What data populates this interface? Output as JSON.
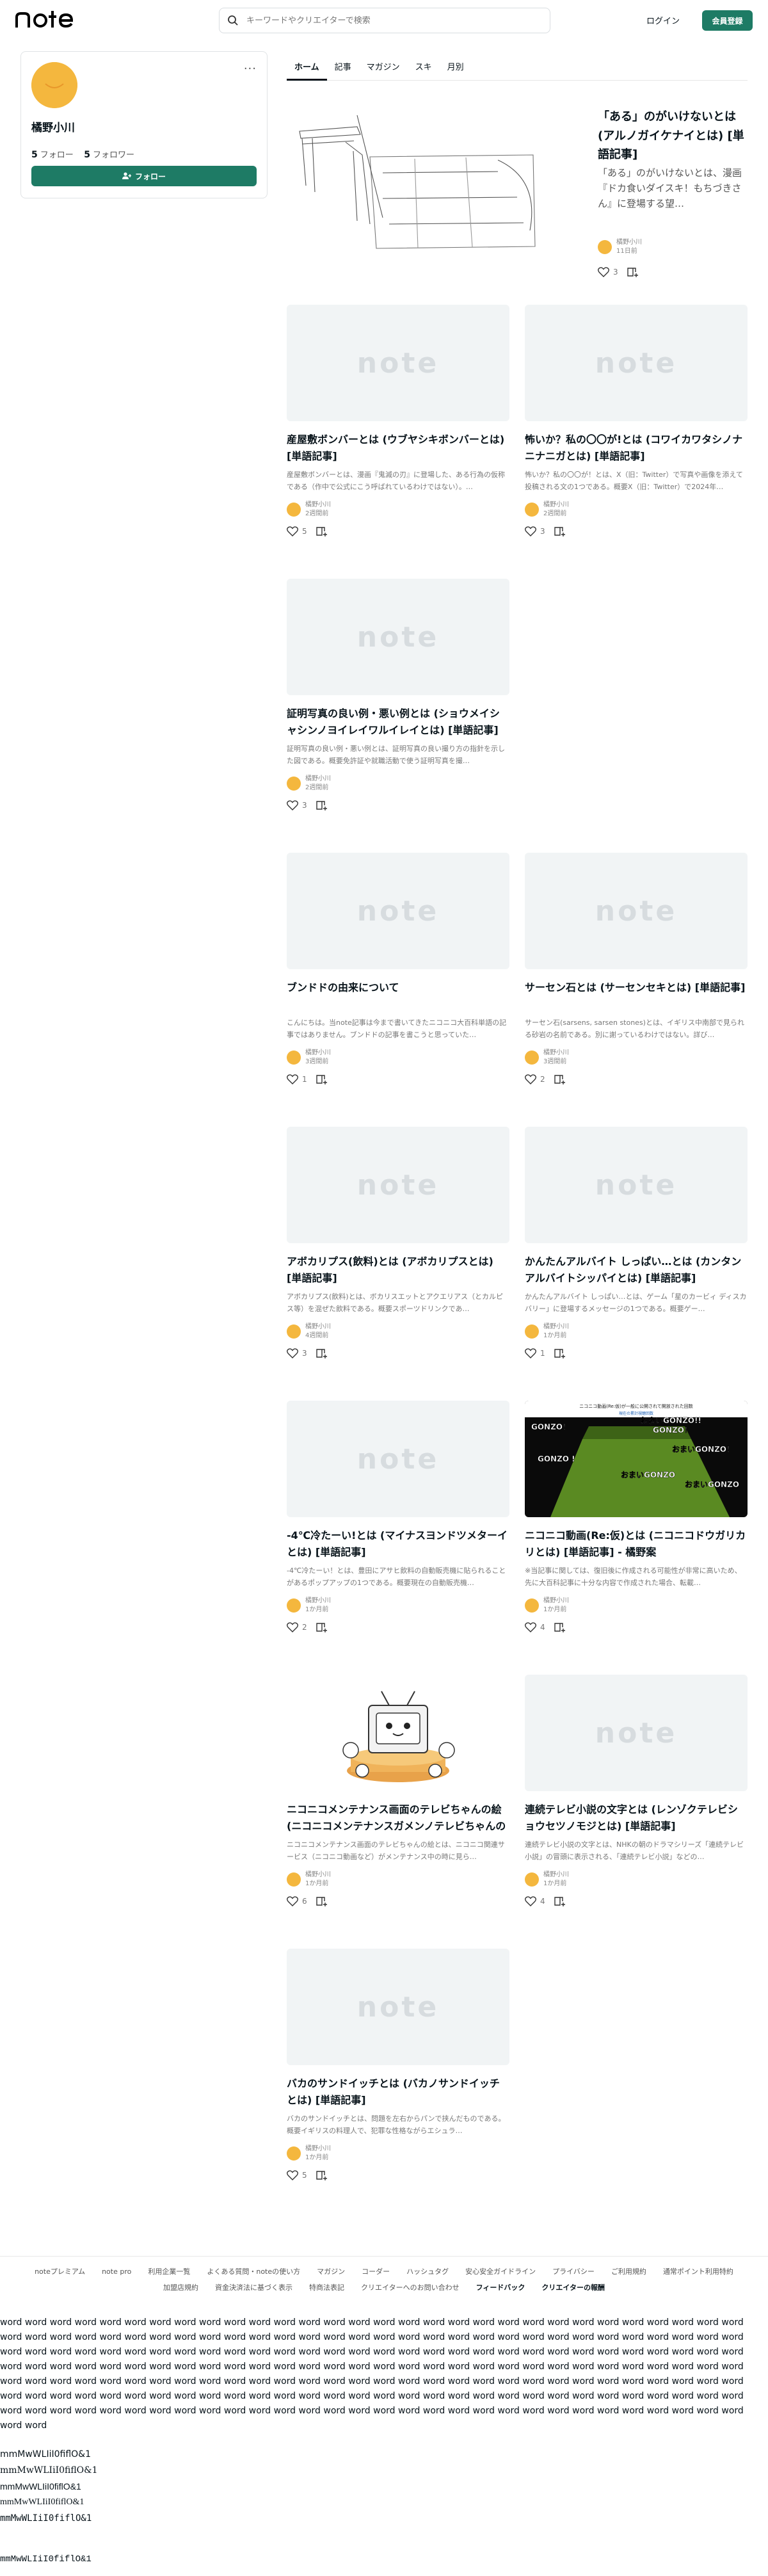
{
  "header": {
    "logo": "note",
    "search_placeholder": "キーワードやクリエイターで検索",
    "login": "ログイン",
    "signup": "会員登録"
  },
  "profile": {
    "name": "橘野小川",
    "following_count": "5",
    "following_label": "フォロー",
    "followers_count": "5",
    "followers_label": "フォロワー",
    "follow_button": "フォロー",
    "more": "···"
  },
  "tabs": [
    "ホーム",
    "記事",
    "マガジン",
    "スキ",
    "月別"
  ],
  "featured": {
    "title": "「ある」のがいけないとは (アルノガイケナイとは) [単語記事]",
    "excerpt": "「ある」のがいけないとは、漫画『ドカ食いダイスキ！もちづきさん』に登場する望…",
    "author": "橘野小川",
    "date": "11日前",
    "likes": "3"
  },
  "thumb_watermark": "note",
  "cards": [
    {
      "title": "産屋敷ボンバーとは (ウブヤシキボンバーとは) [単語記事]",
      "excerpt": "産屋敷ボンバーとは、漫画『鬼滅の刃』に登場した、ある行為の仮称である（作中で公式にこう呼ばれているわけではない）。…",
      "author": "橘野小川",
      "date": "2週間前",
      "likes": "5"
    },
    {
      "title": "怖いか？私の〇〇が!とは (コワイカワタシノナニナニガとは) [単語記事]",
      "excerpt": "怖いか？私の〇〇が！とは、X（旧：Twitter）で写真や画像を添えて投稿される文の1つである。概要X（旧：Twitter）で2024年…",
      "author": "橘野小川",
      "date": "2週間前",
      "likes": "3"
    },
    {
      "title": "証明写真の良い例・悪い例とは (ショウメイシャシンノヨイレイワルイレイとは) [単語記事]",
      "excerpt": "証明写真の良い例・悪い例とは、証明写真の良い撮り方の指針を示した図である。概要免許証や就職活動で使う証明写真を撮…",
      "author": "橘野小川",
      "date": "2週間前",
      "likes": "3"
    },
    {
      "title": "ブンドドの由来について",
      "excerpt": "こんにちは。当note記事は今まで書いてきたニコニコ大百科単語の記事ではありません。ブンドドの記事を書こうと思っていた…",
      "author": "橘野小川",
      "date": "3週間前",
      "likes": "1"
    },
    {
      "title": "サーセン石とは (サーセンセキとは) [単語記事]",
      "excerpt": "サーセン石(sarsens, sarsen stones)とは、イギリス中南部で見られる砂岩の名前である。別に謝っているわけではない。詳び…",
      "author": "橘野小川",
      "date": "3週間前",
      "likes": "2"
    },
    {
      "title": "アボカリプス(飲料)とは (アボカリプスとは) [単語記事]",
      "excerpt": "アボカリプス(飲料)とは、ボカリスエットとアクエリアス（とカルピス等）を混ぜた飲料である。概要スポーツドリンクであ…",
      "author": "橘野小川",
      "date": "4週間前",
      "likes": "3"
    },
    {
      "title": "かんたんアルバイト しっぱい…とは (カンタンアルバイトシッパイとは) [単語記事]",
      "excerpt": "かんたんアルバイト しっぱい…とは、ゲーム「星のカービィ ディスカバリー」に登場するメッセージの1つである。概要ゲー…",
      "author": "橘野小川",
      "date": "1か月前",
      "likes": "1"
    },
    {
      "title": "-4℃冷たーい!とは (マイナスヨンドツメターイとは) [単語記事]",
      "excerpt": "-4℃冷たーい！とは、豊田にアサヒ飲料の自動販売機に貼られることがあるポップアップの1つである。概要現在の自動販売機…",
      "author": "橘野小川",
      "date": "1か月前",
      "likes": "2"
    },
    {
      "title": "ニコニコ動画(Re:仮)とは (ニコニコドウガリカリとは) [単語記事] - 橘野案",
      "excerpt": "※当記事に関しては、復旧後に作成される可能性が非常に高いため、先に大百科記事に十分な内容で作成された場合、転載…",
      "author": "橘野小川",
      "date": "1か月前",
      "likes": "4"
    },
    {
      "title": "ニコニコメンテナンス画面のテレビちゃんの絵 (ニコニコメンテナンスガメンノテレビちゃんの絵) [単語記事]",
      "excerpt": "ニコニコメンテナンス画面のテレビちゃんの絵とは、ニコニコ関連サービス（ニコニコ動画など）がメンテナンス中の時に見ら…",
      "author": "橘野小川",
      "date": "1か月前",
      "likes": "6"
    },
    {
      "title": "連続テレビ小説の文字とは (レンゾクテレビショウセツノモジとは) [単語記事]",
      "excerpt": "連続テレビ小説の文字とは、NHKの朝のドラマシリーズ「連続テレビ小説」の冒頭に表示される、「連続テレビ小説」などの…",
      "author": "橘野小川",
      "date": "1か月前",
      "likes": "4"
    },
    {
      "title": "バカのサンドイッチとは (バカノサンドイッチとは) [単語記事]",
      "excerpt": "バカのサンドイッチとは、問題を左右からパンで挟んだものである。概要イギリスの料理人で、犯罪な性格ながらエシュラ…",
      "author": "橘野小川",
      "date": "1か月前",
      "likes": "5"
    }
  ],
  "nico_thumb": {
    "top_text": "ニコニコ動画(Re:仮)が一般に公開されて開放された回数",
    "sub_text": "現在の累計視聴回数",
    "callouts": [
      "GONZO！",
      "おまいGONZO！",
      "GONZO !",
      "おまいGONZO",
      "おまいGONZO!!",
      "GONZO！",
      "おまいGONZO"
    ]
  },
  "footer": {
    "links_row1": [
      "noteプレミアム",
      "note pro",
      "利用企業一覧",
      "よくある質問・noteの使い方",
      "マガジン",
      "コーダー",
      "ハッシュタグ",
      "安心安全ガイドライン",
      "プライバシー",
      "ご利用規約",
      "通常ポイント利用特約"
    ],
    "links_row2": [
      "加盟店規約",
      "資金決済法に基づく表示",
      "特商法表記",
      "クリエイターへのお問い合わせ"
    ],
    "links_row2_bold": [
      "フィードバック",
      "クリエイターの報酬"
    ]
  },
  "filler_word": "word",
  "mono_text": "mmMwWLIiI0fiflO&1"
}
